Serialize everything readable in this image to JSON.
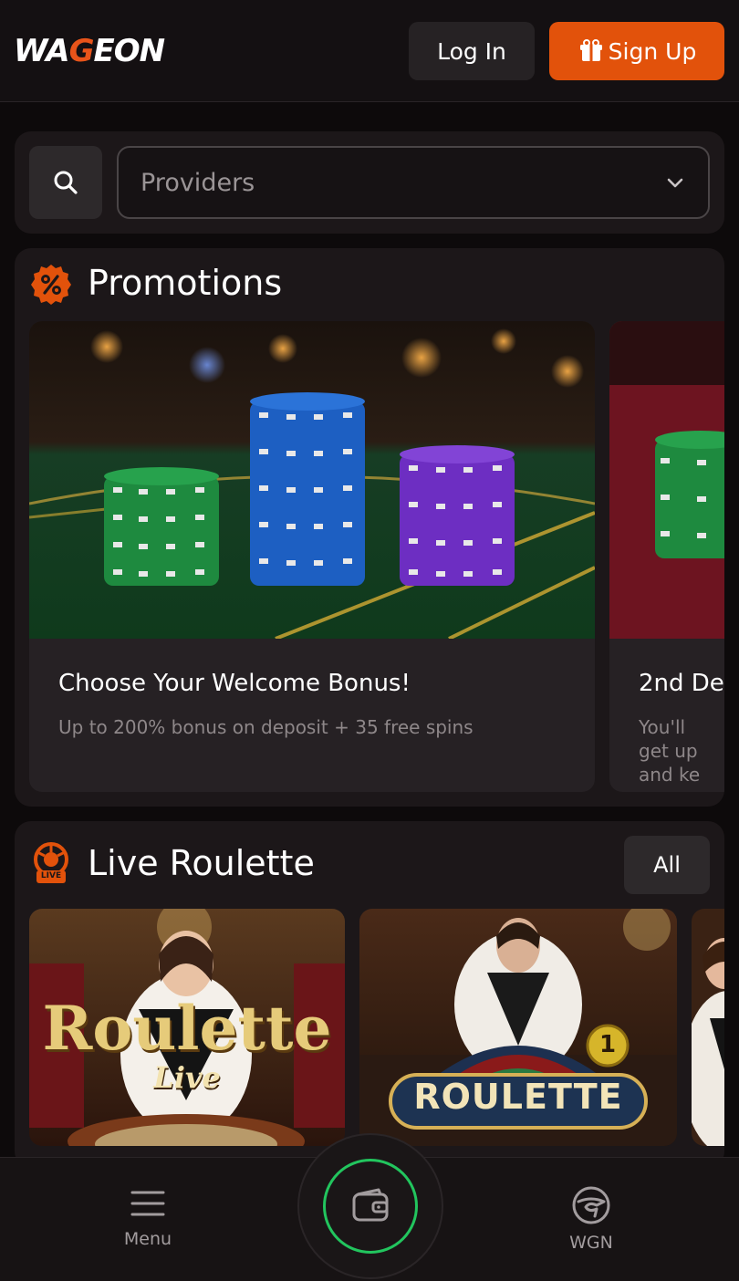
{
  "header": {
    "logo_text_a": "WA",
    "logo_text_g": "G",
    "logo_text_b": "EON",
    "login_label": "Log In",
    "signup_label": "Sign Up"
  },
  "search": {
    "providers_placeholder": "Providers"
  },
  "promotions": {
    "title": "Promotions",
    "cards": [
      {
        "title": "Choose Your Welcome Bonus!",
        "description": "Up to 200% bonus on deposit + 35 free spins"
      },
      {
        "title": "2nd De",
        "description": "You'll get up and ke"
      }
    ]
  },
  "live_roulette": {
    "title": "Live Roulette",
    "all_label": "All",
    "badge": "LIVE",
    "games": [
      {
        "title": "Roulette",
        "subtitle": "Live"
      },
      {
        "title": "ROULETTE",
        "badge_number": "1"
      }
    ]
  },
  "bottom_nav": {
    "menu_label": "Menu",
    "wgn_label": "WGN"
  },
  "colors": {
    "accent": "#e2520b",
    "wallet_ring": "#22c55e",
    "panel": "#1c1719"
  }
}
